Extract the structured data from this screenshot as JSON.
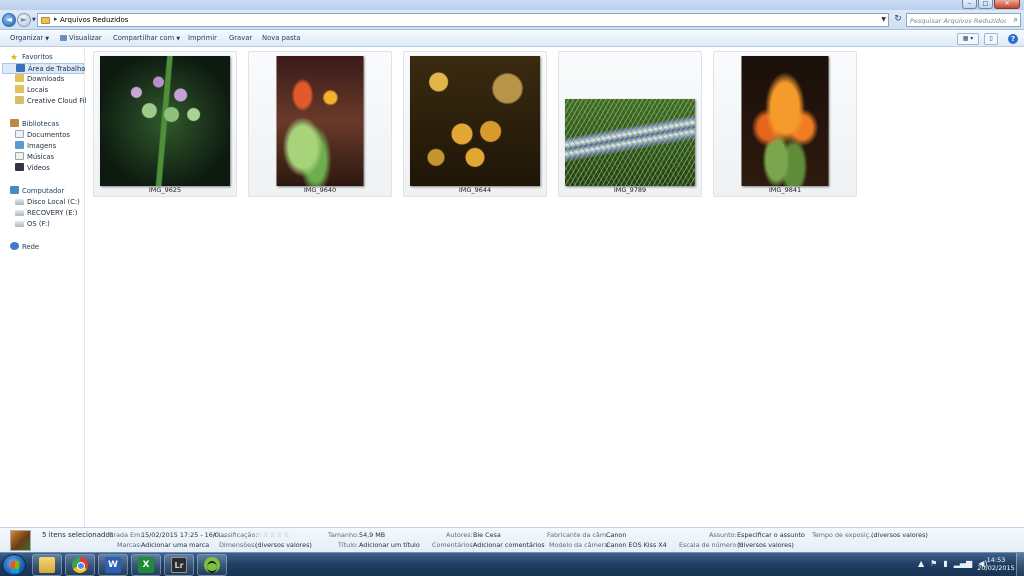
{
  "window": {
    "controls": {
      "minimize": "–",
      "maximize": "□",
      "close": "✕"
    }
  },
  "address": {
    "path": "Arquivos Reduzidos",
    "search_placeholder": "Pesquisar Arquivos Reduzidos"
  },
  "toolbar": {
    "organize": "Organizar",
    "preview": "Visualizar",
    "share": "Compartilhar com",
    "print": "Imprimir",
    "burn": "Gravar",
    "new_folder": "Nova pasta"
  },
  "nav": {
    "favorites": {
      "label": "Favoritos",
      "items": [
        "Área de Trabalho",
        "Downloads",
        "Locais",
        "Creative Cloud Files"
      ]
    },
    "libraries": {
      "label": "Bibliotecas",
      "items": [
        "Documentos",
        "Imagens",
        "Músicas",
        "Vídeos"
      ]
    },
    "computer": {
      "label": "Computador",
      "items": [
        "Disco Local (C:)",
        "RECOVERY (E:)",
        "OS (F:)"
      ]
    },
    "network": {
      "label": "Rede"
    }
  },
  "files": [
    {
      "name": "IMG_9625"
    },
    {
      "name": "IMG_9640"
    },
    {
      "name": "IMG_9644"
    },
    {
      "name": "IMG_9789"
    },
    {
      "name": "IMG_9841"
    }
  ],
  "details": {
    "count": "5 itens selecionados",
    "taken_label": "Tirada Em:",
    "taken_value": "15/02/2015 17:25 - 16/0...",
    "tags_label": "Marcas:",
    "tags_value": "Adicionar uma marca",
    "rating_label": "Classificação:",
    "rating_stars": "☆☆☆☆☆",
    "rating_value": 0,
    "dimensions_label": "Dimensões:",
    "dimensions_value": "(diversos valores)",
    "size_label": "Tamanho:",
    "size_value": "54,9 MB",
    "title_label": "Título:",
    "title_value": "Adicionar um título",
    "authors_label": "Autores:",
    "authors_value": "Bie Cesa",
    "comments_label": "Comentários:",
    "comments_value": "Adicionar comentários",
    "maker_label": "Fabricante da câm...",
    "maker_value": "Canon",
    "model_label": "Modelo da câmera:",
    "model_value": "Canon EOS Kiss X4",
    "subject_label": "Assunto:",
    "subject_value": "Especificar o assunto",
    "fnumber_label": "Escala de número f:",
    "fnumber_value": "(diversos valores)",
    "exposure_label": "Tempo de exposiç...",
    "exposure_value": "(diversos valores)"
  },
  "taskbar": {
    "apps": [
      {
        "icon": "windows-explorer-icon",
        "glyph": ""
      },
      {
        "icon": "chrome-icon",
        "glyph": ""
      },
      {
        "icon": "word-icon",
        "glyph": "W"
      },
      {
        "icon": "excel-icon",
        "glyph": "X"
      },
      {
        "icon": "lightroom-icon",
        "glyph": "Lr"
      },
      {
        "icon": "spotify-icon",
        "glyph": ""
      }
    ],
    "time": "14:53",
    "date": "20/02/2015"
  }
}
